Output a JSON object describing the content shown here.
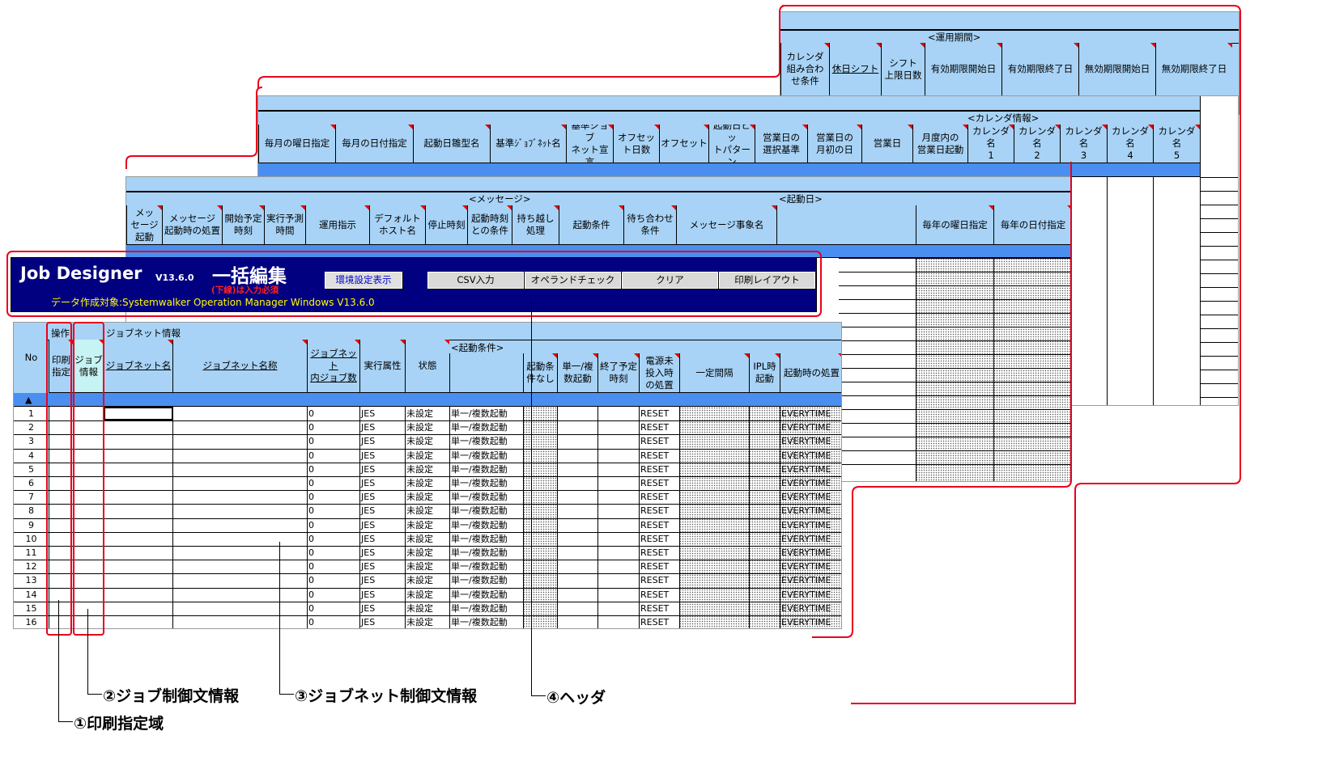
{
  "app": {
    "title": "Job Designer",
    "version": "V13.6.0",
    "mode_title": "一括編集",
    "required_note": "(下線)は入力必須",
    "target": "データ作成対象:Systemwalker Operation Manager Windows V13.6.0"
  },
  "buttons": {
    "env_settings": "環境設定表示",
    "csv_input": "CSV入力",
    "operand_check": "オペランドチェック",
    "clear": "クリア",
    "print_layout": "印刷レイアウト"
  },
  "sheet3": {
    "group_label": "<運用期間>",
    "headers": [
      "カレンダ\n組み合わ\nせ条件",
      "休日シフト",
      "シフト\n上限日数",
      "有効期限開始日",
      "有効期限終了日",
      "無効期限開始日",
      "無効期限終了日"
    ]
  },
  "sheet2": {
    "group_label": "<カレンダ情報>",
    "headers": [
      "毎月の曜日指定",
      "毎月の日付指定",
      "起動日雛型名",
      "基準ｼﾞｮﾌﾞﾈｯﾄ名",
      "基準ジョブ\nネット宣言",
      "オフセッ\nト日数",
      "オフセット",
      "起動日ビッ\nトパターン",
      "営業日の\n選択基準",
      "営業日の\n月初の日",
      "営業日",
      "月度内の\n営業日起動",
      "カレンダ名\n1",
      "カレンダ名\n2",
      "カレンダ名\n3",
      "カレンダ名\n4",
      "カレンダ名\n5"
    ]
  },
  "sheet1": {
    "group_message": "<メッセージ>",
    "group_start_day": "<起動日>",
    "headers": [
      "メッ\nセージ\n起動",
      "メッセージ\n起動時の処置",
      "開始予定\n時刻",
      "実行予測\n時間",
      "運用指示",
      "デフォルト\nホスト名",
      "停止時刻",
      "起動時刻\nとの条件",
      "持ち越し\n処理",
      "起動条件",
      "待ち合わせ\n条件",
      "メッセージ事象名",
      "",
      "毎年の曜日指定",
      "毎年の日付指定"
    ]
  },
  "main": {
    "group_op": "操作",
    "group_jobnet": "ジョブネット情報",
    "group_start_cond": "<起動条件>",
    "col_no": "No",
    "up_arrow": "▲",
    "headers": [
      "印刷\n指定",
      "ジョブ\n情報",
      "ジョブネット名",
      "ジョブネット名称",
      "ジョブネット\n内ジョブ数",
      "実行属性",
      "状態",
      "",
      "起動条\n件なし",
      "単一/複\n数起動",
      "終了予定\n時刻",
      "電源未\n投入時\nの処置",
      "一定間隔",
      "IPL時\n起動",
      "起動時の処置"
    ],
    "rows": [
      {
        "no": "1",
        "jobs": "0",
        "attr": "JES",
        "state": "未設定",
        "mode": "単一/複数起動",
        "power": "RESET",
        "action": "EVERYTIME"
      },
      {
        "no": "2",
        "jobs": "0",
        "attr": "JES",
        "state": "未設定",
        "mode": "単一/複数起動",
        "power": "RESET",
        "action": "EVERYTIME"
      },
      {
        "no": "3",
        "jobs": "0",
        "attr": "JES",
        "state": "未設定",
        "mode": "単一/複数起動",
        "power": "RESET",
        "action": "EVERYTIME"
      },
      {
        "no": "4",
        "jobs": "0",
        "attr": "JES",
        "state": "未設定",
        "mode": "単一/複数起動",
        "power": "RESET",
        "action": "EVERYTIME"
      },
      {
        "no": "5",
        "jobs": "0",
        "attr": "JES",
        "state": "未設定",
        "mode": "単一/複数起動",
        "power": "RESET",
        "action": "EVERYTIME"
      },
      {
        "no": "6",
        "jobs": "0",
        "attr": "JES",
        "state": "未設定",
        "mode": "単一/複数起動",
        "power": "RESET",
        "action": "EVERYTIME"
      },
      {
        "no": "7",
        "jobs": "0",
        "attr": "JES",
        "state": "未設定",
        "mode": "単一/複数起動",
        "power": "RESET",
        "action": "EVERYTIME"
      },
      {
        "no": "8",
        "jobs": "0",
        "attr": "JES",
        "state": "未設定",
        "mode": "単一/複数起動",
        "power": "RESET",
        "action": "EVERYTIME"
      },
      {
        "no": "9",
        "jobs": "0",
        "attr": "JES",
        "state": "未設定",
        "mode": "単一/複数起動",
        "power": "RESET",
        "action": "EVERYTIME"
      },
      {
        "no": "10",
        "jobs": "0",
        "attr": "JES",
        "state": "未設定",
        "mode": "単一/複数起動",
        "power": "RESET",
        "action": "EVERYTIME"
      },
      {
        "no": "11",
        "jobs": "0",
        "attr": "JES",
        "state": "未設定",
        "mode": "単一/複数起動",
        "power": "RESET",
        "action": "EVERYTIME"
      },
      {
        "no": "12",
        "jobs": "0",
        "attr": "JES",
        "state": "未設定",
        "mode": "単一/複数起動",
        "power": "RESET",
        "action": "EVERYTIME"
      },
      {
        "no": "13",
        "jobs": "0",
        "attr": "JES",
        "state": "未設定",
        "mode": "単一/複数起動",
        "power": "RESET",
        "action": "EVERYTIME"
      },
      {
        "no": "14",
        "jobs": "0",
        "attr": "JES",
        "state": "未設定",
        "mode": "単一/複数起動",
        "power": "RESET",
        "action": "EVERYTIME"
      },
      {
        "no": "15",
        "jobs": "0",
        "attr": "JES",
        "state": "未設定",
        "mode": "単一/複数起動",
        "power": "RESET",
        "action": "EVERYTIME"
      },
      {
        "no": "16",
        "jobs": "0",
        "attr": "JES",
        "state": "未設定",
        "mode": "単一/複数起動",
        "power": "RESET",
        "action": "EVERYTIME"
      }
    ]
  },
  "callouts": {
    "c1": "①印刷指定域",
    "c2": "②ジョブ制御文情報",
    "c3": "③ジョブネット制御文情報",
    "c4": "④ヘッダ"
  },
  "colors": {
    "header_bg": "#a8d3f6",
    "header_band": "#4a8ff0",
    "title_bar": "#000080",
    "highlight": "#e8001c",
    "cell_marker": "#e00000"
  }
}
